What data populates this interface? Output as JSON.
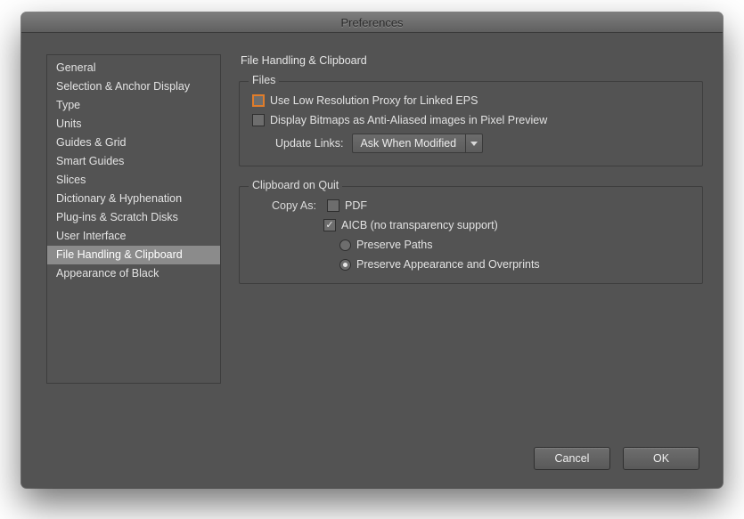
{
  "window": {
    "title": "Preferences"
  },
  "sidebar": {
    "items": [
      {
        "label": "General"
      },
      {
        "label": "Selection & Anchor Display"
      },
      {
        "label": "Type"
      },
      {
        "label": "Units"
      },
      {
        "label": "Guides & Grid"
      },
      {
        "label": "Smart Guides"
      },
      {
        "label": "Slices"
      },
      {
        "label": "Dictionary & Hyphenation"
      },
      {
        "label": "Plug-ins & Scratch Disks"
      },
      {
        "label": "User Interface"
      },
      {
        "label": "File Handling & Clipboard"
      },
      {
        "label": "Appearance of Black"
      }
    ],
    "selected_index": 10
  },
  "main": {
    "title": "File Handling & Clipboard",
    "files_group": {
      "legend": "Files",
      "low_res_proxy": {
        "label": "Use Low Resolution Proxy for Linked EPS",
        "checked": false,
        "highlighted": true
      },
      "display_bitmaps": {
        "label": "Display Bitmaps as Anti-Aliased images in Pixel Preview",
        "checked": false
      },
      "update_links": {
        "label": "Update Links:",
        "value": "Ask When Modified"
      }
    },
    "clipboard_group": {
      "legend": "Clipboard on Quit",
      "copy_as_label": "Copy As:",
      "pdf": {
        "label": "PDF",
        "checked": false
      },
      "aicb": {
        "label": "AICB (no transparency support)",
        "checked": true
      },
      "preserve_paths": {
        "label": "Preserve Paths",
        "selected": false
      },
      "preserve_appearance": {
        "label": "Preserve Appearance and Overprints",
        "selected": true
      }
    }
  },
  "footer": {
    "cancel": "Cancel",
    "ok": "OK"
  }
}
